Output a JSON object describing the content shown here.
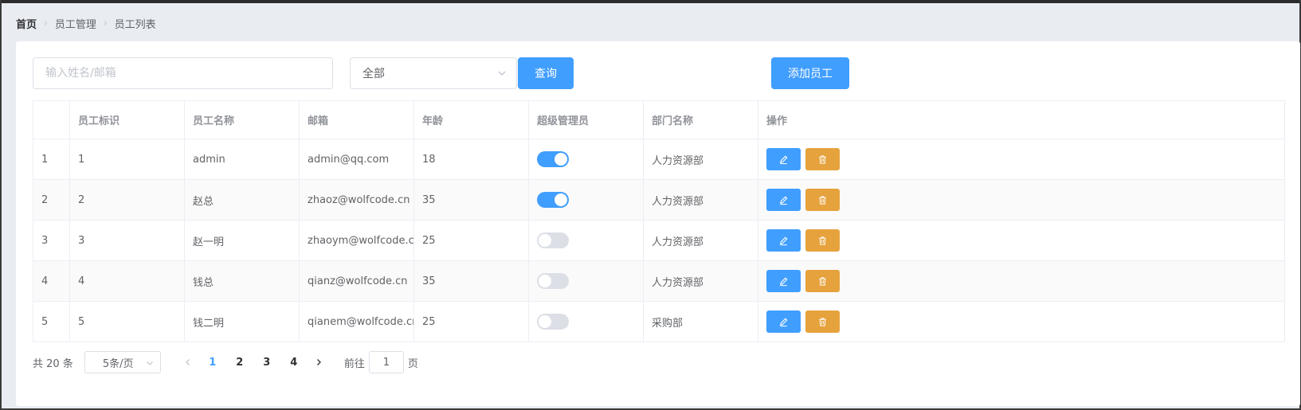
{
  "breadcrumb": [
    "首页",
    "员工管理",
    "员工列表"
  ],
  "search": {
    "placeholder": "输入姓名/邮箱",
    "value": ""
  },
  "filter": {
    "selected": "全部"
  },
  "buttons": {
    "query": "查询",
    "add": "添加员工"
  },
  "table": {
    "columns": [
      "",
      "员工标识",
      "员工名称",
      "邮箱",
      "年龄",
      "超级管理员",
      "部门名称",
      "操作"
    ],
    "rows": [
      {
        "index": "1",
        "id": "1",
        "name": "admin",
        "email": "admin@qq.com",
        "age": "18",
        "admin": true,
        "dept": "人力资源部"
      },
      {
        "index": "2",
        "id": "2",
        "name": "赵总",
        "email": "zhaoz@wolfcode.cn",
        "age": "35",
        "admin": true,
        "dept": "人力资源部"
      },
      {
        "index": "3",
        "id": "3",
        "name": "赵一明",
        "email": "zhaoym@wolfcode.cn",
        "age": "25",
        "admin": false,
        "dept": "人力资源部"
      },
      {
        "index": "4",
        "id": "4",
        "name": "钱总",
        "email": "qianz@wolfcode.cn",
        "age": "35",
        "admin": false,
        "dept": "人力资源部"
      },
      {
        "index": "5",
        "id": "5",
        "name": "钱二明",
        "email": "qianem@wolfcode.cn",
        "age": "25",
        "admin": false,
        "dept": "采购部"
      }
    ]
  },
  "pagination": {
    "total": "共 20 条",
    "page_size": "5条/页",
    "pages": [
      "1",
      "2",
      "3",
      "4"
    ],
    "current": "1",
    "goto_prefix": "前往",
    "goto_value": "1",
    "goto_suffix": "页"
  },
  "colors": {
    "primary": "#409eff",
    "warning": "#e6a23c",
    "switch_off": "#dcdfe6"
  },
  "icons": {
    "edit": "edit-icon",
    "delete": "delete-icon",
    "chevron": "chevron-down-icon",
    "prev": "chevron-left-icon",
    "next": "chevron-right-icon"
  }
}
